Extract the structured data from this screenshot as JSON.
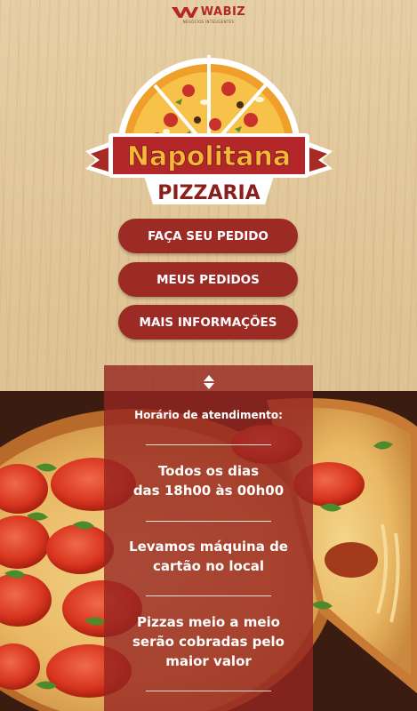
{
  "brand": {
    "name": "WABIZ",
    "tagline": "NEGÓCIOS INTELIGENTES"
  },
  "logo": {
    "name": "Napolitana",
    "subtitle": "PIZZARIA"
  },
  "menu": {
    "order_label": "FAÇA SEU PEDIDO",
    "my_orders_label": "MEUS PEDIDOS",
    "more_info_label": "MAIS INFORMAÇÕES"
  },
  "info": {
    "title": "Horário de atendimento:",
    "hours_line1": "Todos os dias",
    "hours_line2": "das 18h00 às 00h00",
    "card_line1": "Levamos máquina de",
    "card_line2": "cartão no local",
    "half_line1": "Pizzas meio a meio",
    "half_line2": "serão cobradas pelo",
    "half_line3": "maior valor"
  },
  "colors": {
    "accent": "#9c2b25",
    "brand_red": "#b3262a",
    "logo_orange": "#e8a62a"
  },
  "icons": {
    "toggle": "up-down-chevrons-icon"
  }
}
